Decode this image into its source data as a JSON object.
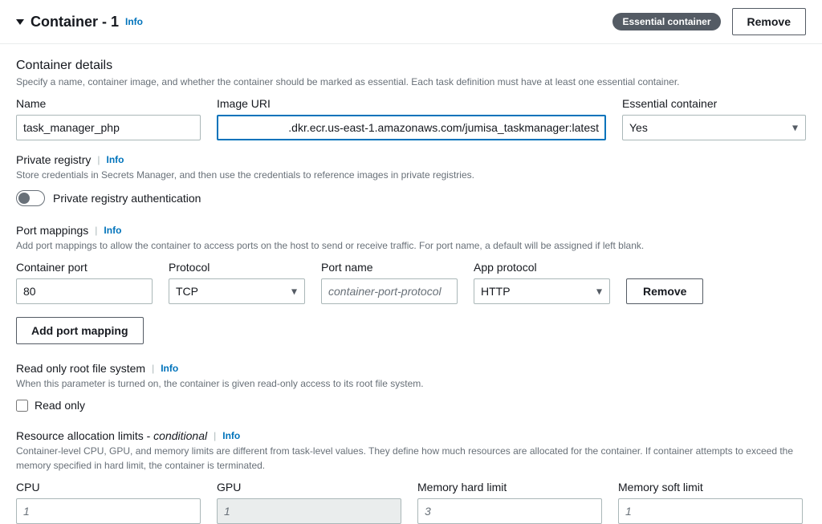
{
  "header": {
    "title": "Container - 1",
    "info": "Info",
    "badge": "Essential container",
    "remove": "Remove"
  },
  "details": {
    "title": "Container details",
    "desc": "Specify a name, container image, and whether the container should be marked as essential. Each task definition must have at least one essential container.",
    "name_label": "Name",
    "name_value": "task_manager_php",
    "image_label": "Image URI",
    "image_value": ".dkr.ecr.us-east-1.amazonaws.com/jumisa_taskmanager:latest",
    "essential_label": "Essential container",
    "essential_value": "Yes"
  },
  "private_registry": {
    "title": "Private registry",
    "info": "Info",
    "desc": "Store credentials in Secrets Manager, and then use the credentials to reference images in private registries.",
    "toggle_label": "Private registry authentication"
  },
  "port_mappings": {
    "title": "Port mappings",
    "info": "Info",
    "desc": "Add port mappings to allow the container to access ports on the host to send or receive traffic. For port name, a default will be assigned if left blank.",
    "container_port_label": "Container port",
    "container_port_value": "80",
    "protocol_label": "Protocol",
    "protocol_value": "TCP",
    "port_name_label": "Port name",
    "port_name_placeholder": "container-port-protocol",
    "app_protocol_label": "App protocol",
    "app_protocol_value": "HTTP",
    "remove": "Remove",
    "add": "Add port mapping"
  },
  "rofs": {
    "title": "Read only root file system",
    "info": "Info",
    "desc": "When this parameter is turned on, the container is given read-only access to its root file system.",
    "checkbox_label": "Read only"
  },
  "resources": {
    "title_prefix": "Resource allocation limits - ",
    "title_italic": "conditional",
    "info": "Info",
    "desc": "Container-level CPU, GPU, and memory limits are different from task-level values. They define how much resources are allocated for the container. If container attempts to exceed the memory specified in hard limit, the container is terminated.",
    "cpu_label": "CPU",
    "cpu_placeholder": "1",
    "gpu_label": "GPU",
    "gpu_placeholder": "1",
    "mem_hard_label": "Memory hard limit",
    "mem_hard_placeholder": "3",
    "mem_soft_label": "Memory soft limit",
    "mem_soft_placeholder": "1"
  }
}
